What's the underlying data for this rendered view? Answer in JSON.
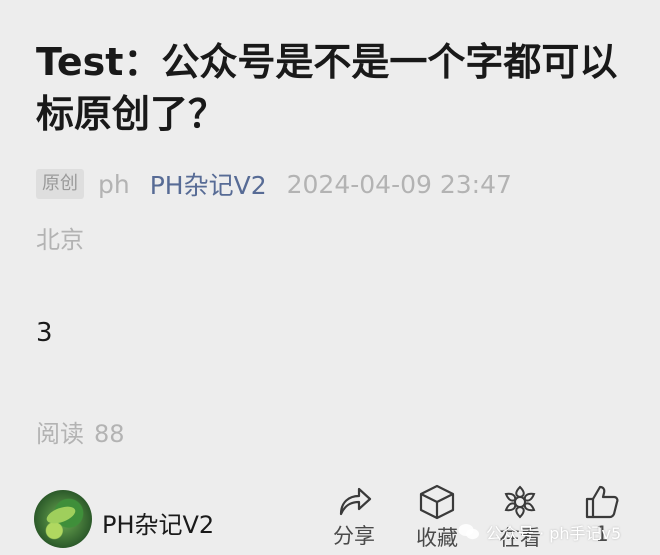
{
  "article": {
    "title": "Test：公众号是不是一个字都可以标原创了？",
    "badge": "原创",
    "author": "ph",
    "account": "PH杂记V2",
    "datetime": "2024-04-09 23:47",
    "location": "北京",
    "body": "3",
    "reads_label": "阅读",
    "reads_count": "88"
  },
  "footer": {
    "account_name": "PH杂记V2",
    "actions": [
      {
        "label": "分享",
        "icon": "share-icon"
      },
      {
        "label": "收藏",
        "icon": "bookmark-cube-icon"
      },
      {
        "label": "在看",
        "icon": "wow-flower-icon"
      },
      {
        "label": "",
        "icon": "thumbs-up-icon",
        "count": "1"
      }
    ],
    "watermark": "公众号 · ph手记v5"
  },
  "colors": {
    "background": "#ededed",
    "link": "#576b95",
    "muted": "#b3b3b3"
  }
}
